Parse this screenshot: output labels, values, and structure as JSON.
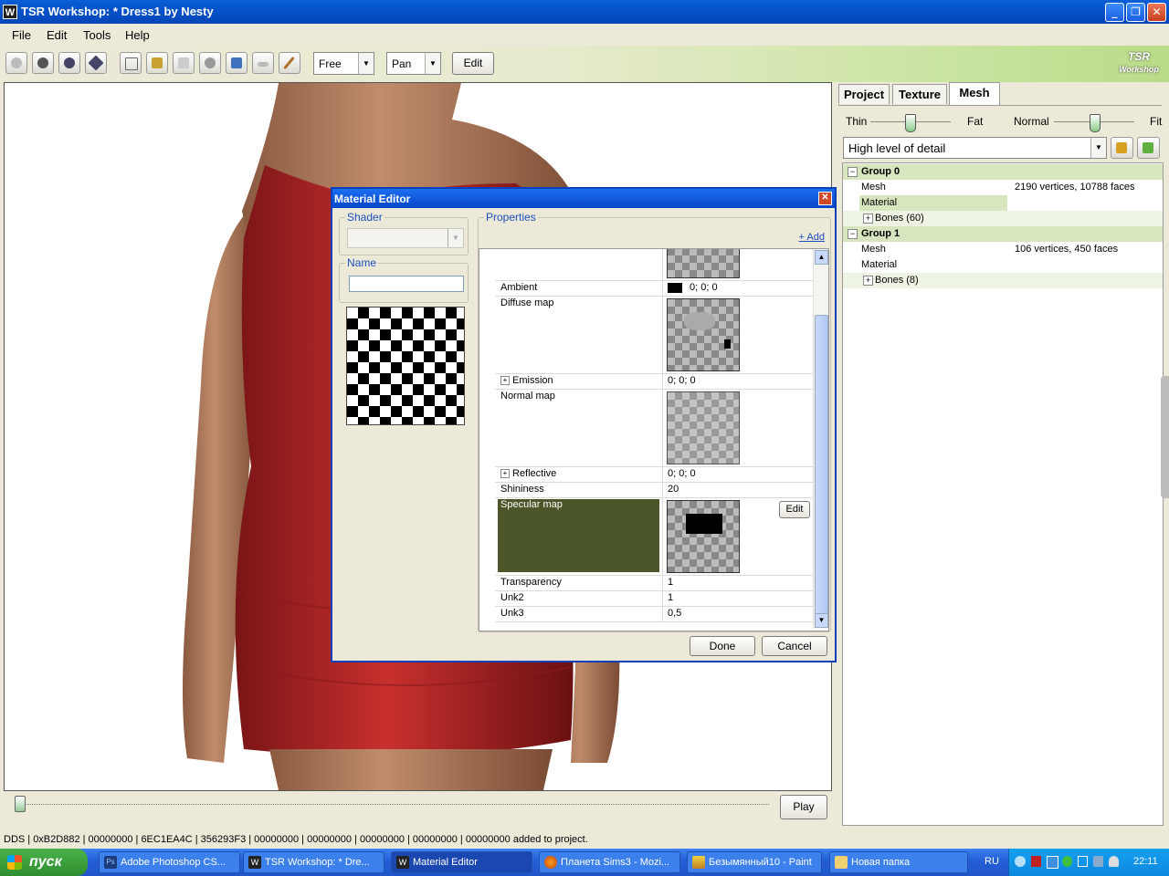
{
  "window": {
    "title": "TSR Workshop: * Dress1 by Nesty",
    "app_icon": "W"
  },
  "menu": [
    "File",
    "Edit",
    "Tools",
    "Help"
  ],
  "toolbar": {
    "mode_combo": "Free",
    "nav_combo": "Pan",
    "edit_label": "Edit",
    "logo": "TSR Workshop"
  },
  "timeline": {
    "play_label": "Play"
  },
  "status_text": "DDS | 0xB2D882 | 00000000 | 6EC1EA4C | 356293F3 | 00000000 | 00000000 | 00000000 | 00000000 | 00000000 added to project.",
  "right_panel": {
    "tabs": [
      "Project",
      "Texture",
      "Mesh"
    ],
    "active_tab": "Mesh",
    "slider1": {
      "left": "Thin",
      "right": "Fat"
    },
    "slider2": {
      "left": "Normal",
      "right": "Fit"
    },
    "lod_select": "High level of detail",
    "tree": [
      {
        "type": "group",
        "label": "Group 0"
      },
      {
        "type": "row",
        "key": "Mesh",
        "value": "2190 vertices, 10788 faces"
      },
      {
        "type": "row",
        "key": "Material",
        "value": "",
        "selected": true
      },
      {
        "type": "sub",
        "key": "Bones (60)"
      },
      {
        "type": "group",
        "label": "Group 1"
      },
      {
        "type": "row",
        "key": "Mesh",
        "value": "106 vertices, 450 faces"
      },
      {
        "type": "row",
        "key": "Material",
        "value": ""
      },
      {
        "type": "sub",
        "key": "Bones (8)"
      }
    ]
  },
  "dialog": {
    "title": "Material Editor",
    "shader_label": "Shader",
    "name_label": "Name",
    "name_value": "",
    "properties_label": "Properties",
    "add_link": "+ Add",
    "properties": {
      "ambient": {
        "key": "Ambient",
        "value": "0; 0; 0"
      },
      "diffuse": {
        "key": "Diffuse map"
      },
      "emission": {
        "key": "Emission",
        "value": "0; 0; 0"
      },
      "normal": {
        "key": "Normal map"
      },
      "reflective": {
        "key": "Reflective",
        "value": "0; 0; 0"
      },
      "shininess": {
        "key": "Shininess",
        "value": "20"
      },
      "specular": {
        "key": "Specular map",
        "edit": "Edit"
      },
      "transparency": {
        "key": "Transparency",
        "value": "1"
      },
      "unk2": {
        "key": "Unk2",
        "value": "1"
      },
      "unk3": {
        "key": "Unk3",
        "value": "0,5"
      }
    },
    "done_label": "Done",
    "cancel_label": "Cancel"
  },
  "taskbar": {
    "start": "пуск",
    "tasks": [
      {
        "label": "Adobe Photoshop CS...",
        "icon": "photoshop-icon"
      },
      {
        "label": "TSR Workshop: * Dre...",
        "icon": "tsr-icon"
      },
      {
        "label": "Material Editor",
        "icon": "tsr-icon"
      },
      {
        "label": "Планета Sims3 - Mozi...",
        "icon": "firefox-icon"
      },
      {
        "label": "Безымянный10 - Paint",
        "icon": "paint-icon"
      },
      {
        "label": "Новая папка",
        "icon": "folder-icon"
      }
    ],
    "lang": "RU",
    "clock": "22:11"
  },
  "colors": {
    "selected_row": "#4b5629",
    "group_row": "#d8e6c0",
    "dress": "#b8282a"
  }
}
